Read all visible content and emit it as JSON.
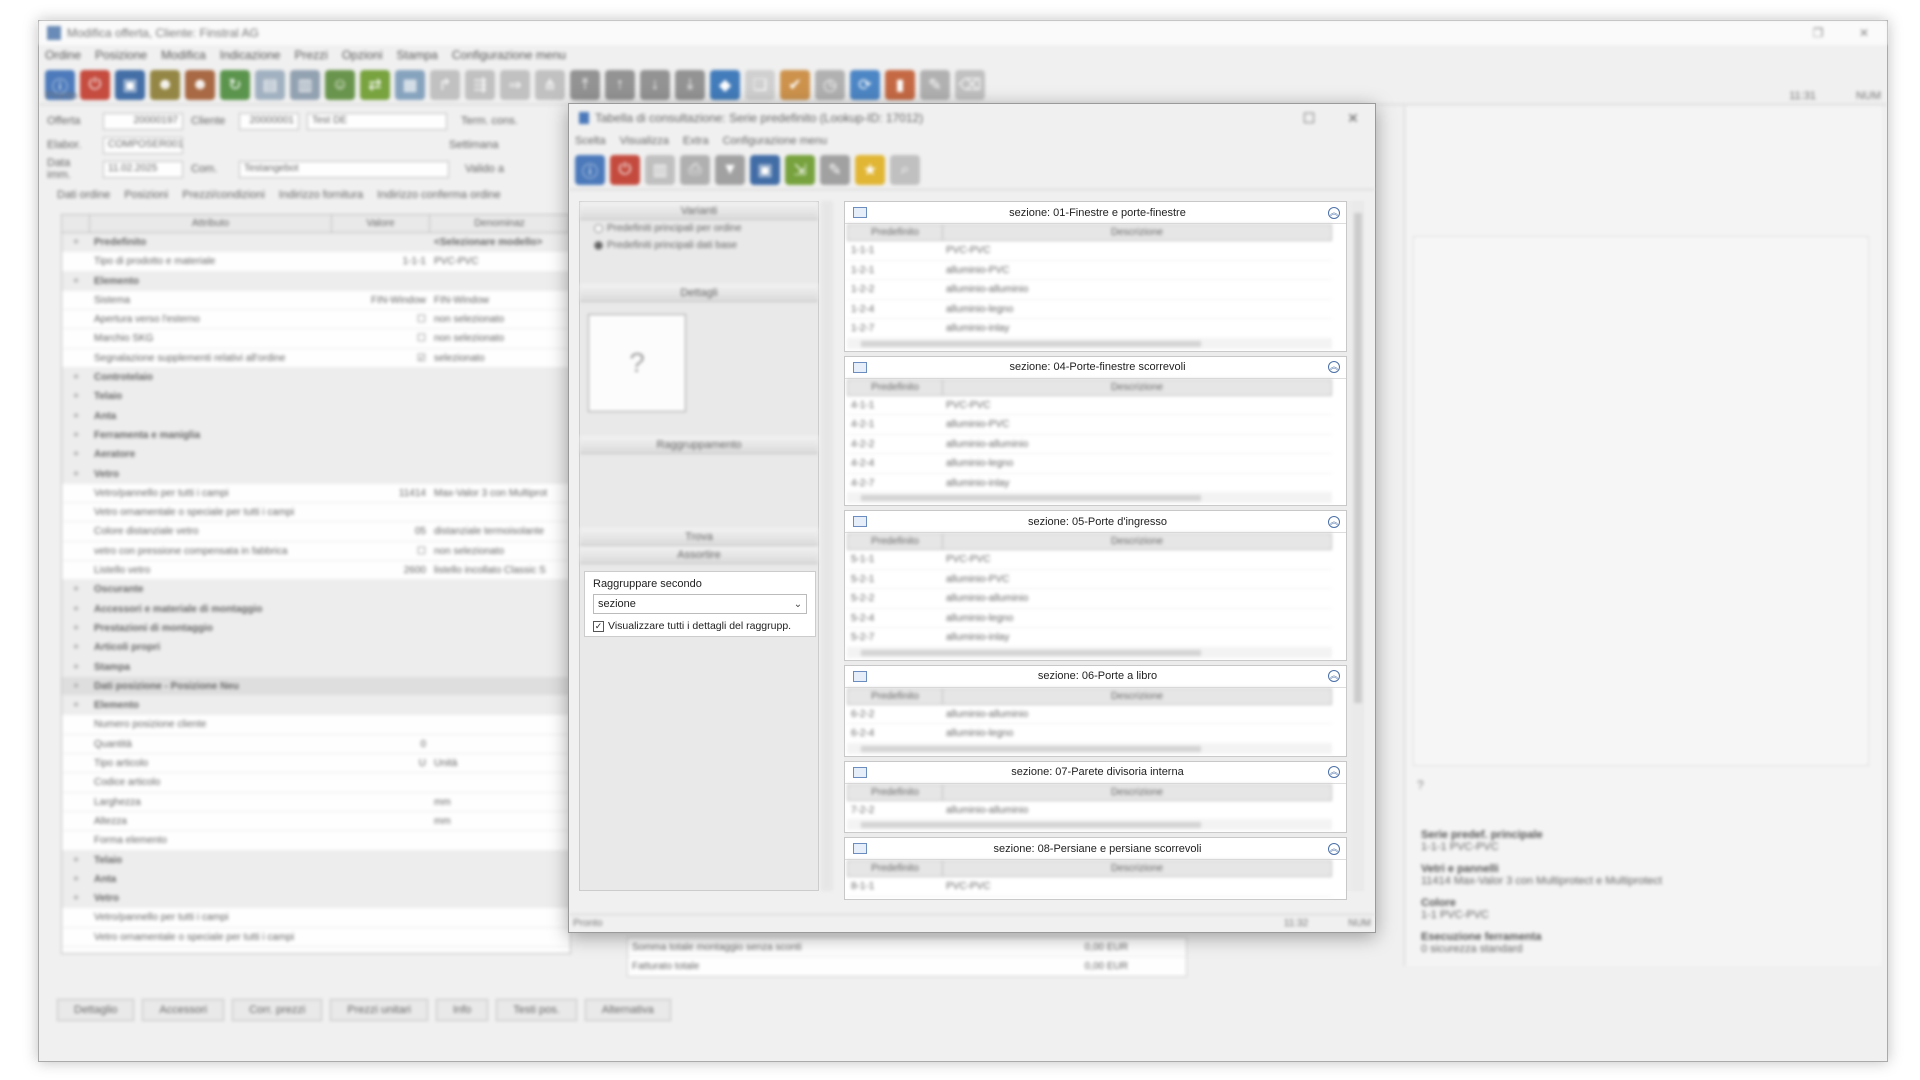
{
  "main": {
    "title": "Modifica offerta, Cliente: Finstral AG",
    "menu": [
      "Ordine",
      "Posizione",
      "Modifica",
      "Indicazione",
      "Prezzi",
      "Opzioni",
      "Stampa",
      "Configurazione menu"
    ],
    "header": {
      "offerta_label": "Offerta",
      "offerta_value": "20000197",
      "cliente_label": "Cliente",
      "cliente_value": "20000001",
      "cliente_name": "Test DE",
      "elabor_label": "Elabor.",
      "elabor_value": "COMPOSER001",
      "data_label": "Data imm.",
      "data_value": "11.02.2025",
      "com_label": "Com.",
      "com_value": "Testangebot",
      "term_label": "Term. cons.",
      "settimana_label": "Settimana",
      "valido_label": "Valido a"
    },
    "tabs": [
      "Dati ordine",
      "Posizioni",
      "Prezzi/condizioni",
      "Indirizzo fornitura",
      "Indirizzo conferma ordine"
    ],
    "prop_headers": [
      "Attributo",
      "Valore",
      "Denominaz"
    ],
    "props": [
      {
        "t": "grp",
        "a": "Predefinito",
        "v": "",
        "d": "<Selezionare modello>"
      },
      {
        "t": "",
        "a": "Tipo di prodotto e materiale",
        "v": "1-1-1",
        "d": "PVC-PVC"
      },
      {
        "t": "grp",
        "a": "Elemento",
        "v": "",
        "d": ""
      },
      {
        "t": "",
        "a": "Sistema",
        "v": "FIN-Window",
        "d": "FIN-Window"
      },
      {
        "t": "",
        "a": "Apertura verso l'esterno",
        "v": "☐",
        "d": "non selezionato"
      },
      {
        "t": "",
        "a": "Marchio SKG",
        "v": "☐",
        "d": "non selezionato"
      },
      {
        "t": "",
        "a": "Segnalazione supplementi relativi all'ordine",
        "v": "☑",
        "d": "selezionato"
      },
      {
        "t": "grp",
        "a": "Controtelaio",
        "v": "",
        "d": ""
      },
      {
        "t": "grp",
        "a": "Telaio",
        "v": "",
        "d": ""
      },
      {
        "t": "grp",
        "a": "Anta",
        "v": "",
        "d": ""
      },
      {
        "t": "grp",
        "a": "Ferramenta e maniglia",
        "v": "",
        "d": ""
      },
      {
        "t": "grp",
        "a": "Aeratore",
        "v": "",
        "d": ""
      },
      {
        "t": "grp",
        "a": "Vetro",
        "v": "",
        "d": ""
      },
      {
        "t": "",
        "a": "Vetro/pannello per tutti i campi",
        "v": "11414",
        "d": "Max-Valor 3 con Multiprot"
      },
      {
        "t": "",
        "a": "Vetro ornamentale o speciale per tutti i campi",
        "v": "",
        "d": ""
      },
      {
        "t": "",
        "a": "Colore distanziale vetro",
        "v": "05",
        "d": "distanziale termoisolante"
      },
      {
        "t": "",
        "a": "vetro con pressione compensata in fabbrica",
        "v": "☐",
        "d": "non selezionato"
      },
      {
        "t": "",
        "a": "Listello vetro",
        "v": "2600",
        "d": "listello incollato Classic S"
      },
      {
        "t": "grp",
        "a": "Oscurante",
        "v": "",
        "d": ""
      },
      {
        "t": "grp",
        "a": "Accessori e materiale di montaggio",
        "v": "",
        "d": ""
      },
      {
        "t": "grp",
        "a": "Prestazioni di montaggio",
        "v": "",
        "d": ""
      },
      {
        "t": "grp",
        "a": "Articoli propri",
        "v": "",
        "d": ""
      },
      {
        "t": "grp",
        "a": "Stampa",
        "v": "",
        "d": ""
      },
      {
        "t": "sec",
        "a": "Dati posizione - Posizione Neu",
        "v": "",
        "d": ""
      },
      {
        "t": "grp",
        "a": "Elemento",
        "v": "",
        "d": ""
      },
      {
        "t": "",
        "a": "Numero posizione cliente",
        "v": "",
        "d": ""
      },
      {
        "t": "",
        "a": "Quantità",
        "v": "0",
        "d": ""
      },
      {
        "t": "",
        "a": "Tipo articolo",
        "v": "U",
        "d": "Unità"
      },
      {
        "t": "",
        "a": "Codice articolo",
        "v": "",
        "d": ""
      },
      {
        "t": "",
        "a": "Larghezza",
        "v": "",
        "d": "mm"
      },
      {
        "t": "",
        "a": "Altezza",
        "v": "",
        "d": "mm"
      },
      {
        "t": "",
        "a": "Forma elemento",
        "v": "",
        "d": ""
      },
      {
        "t": "grp",
        "a": "Telaio",
        "v": "",
        "d": ""
      },
      {
        "t": "grp",
        "a": "Anta",
        "v": "",
        "d": ""
      },
      {
        "t": "grp",
        "a": "Vetro",
        "v": "",
        "d": ""
      },
      {
        "t": "",
        "a": "Vetro/pannello per tutti i campi",
        "v": "",
        "d": ""
      },
      {
        "t": "",
        "a": "Vetro ornamentale o speciale per tutti i campi",
        "v": "",
        "d": ""
      }
    ],
    "sums": [
      {
        "label": "Somma totale montaggio senza sconti",
        "value": "0,00 EUR"
      },
      {
        "label": "Fatturato totale",
        "value": "0,00 EUR"
      }
    ],
    "bottom_buttons": [
      "Dettaglio",
      "Accessori",
      "Corr. prezzi",
      "Prezzi unitari",
      "Info",
      "Testi pos.",
      "Alternativa"
    ],
    "status_left": "Pronto",
    "status_time": "11:31",
    "status_num": "NUM",
    "info": {
      "q": "?",
      "s1_title": "Serie predef. principale",
      "s1_val": "1-1-1   PVC-PVC",
      "s2_title": "Vetri e pannelli",
      "s2_val": "11414   Max-Valor 3 con Multiprotect e Multiprotect",
      "s3_title": "Colore",
      "s3_val": "1-1   PVC-PVC",
      "s4_title": "Esecuzione ferramenta",
      "s4_val": "0       sicurezza standard"
    }
  },
  "dialog": {
    "title": "Tabella di consultazione: Serie predefinito (Lookup-ID: 17012)",
    "menu": [
      "Scelta",
      "Visualizza",
      "Extra",
      "Configurazione menu"
    ],
    "left": {
      "varianti_label": "Varianti",
      "radio1": "Predefiniti principali per ordine",
      "radio2": "Predefiniti principali dati base",
      "dettagli_label": "Dettagli",
      "q": "?",
      "raggr_label": "Raggruppamento",
      "group_by_label": "Raggruppare secondo",
      "group_by_value": "sezione",
      "show_all_label": "Visualizzare tutti i dettagli del raggrupp.",
      "trova_label": "Trova",
      "assortire_label": "Assortire"
    },
    "col_pred": "Predefinito",
    "col_desc": "Descrizione",
    "sections": [
      {
        "title": "sezione: 01-Finestre e porte-finestre",
        "rows": [
          [
            "1-1-1",
            "PVC-PVC"
          ],
          [
            "1-2-1",
            "alluminio-PVC"
          ],
          [
            "1-2-2",
            "alluminio-alluminio"
          ],
          [
            "1-2-4",
            "alluminio-legno"
          ],
          [
            "1-2-7",
            "alluminio-inlay"
          ]
        ]
      },
      {
        "title": "sezione: 04-Porte-finestre scorrevoli",
        "rows": [
          [
            "4-1-1",
            "PVC-PVC"
          ],
          [
            "4-2-1",
            "alluminio-PVC"
          ],
          [
            "4-2-2",
            "alluminio-alluminio"
          ],
          [
            "4-2-4",
            "alluminio-legno"
          ],
          [
            "4-2-7",
            "alluminio-inlay"
          ]
        ]
      },
      {
        "title": "sezione: 05-Porte d'ingresso",
        "rows": [
          [
            "5-1-1",
            "PVC-PVC"
          ],
          [
            "5-2-1",
            "alluminio-PVC"
          ],
          [
            "5-2-2",
            "alluminio-alluminio"
          ],
          [
            "5-2-4",
            "alluminio-legno"
          ],
          [
            "5-2-7",
            "alluminio-inlay"
          ]
        ]
      },
      {
        "title": "sezione: 06-Porte a libro",
        "rows": [
          [
            "6-2-2",
            "alluminio-alluminio"
          ],
          [
            "6-2-4",
            "alluminio-legno"
          ]
        ]
      },
      {
        "title": "sezione: 07-Parete divisoria interna",
        "rows": [
          [
            "7-2-2",
            "alluminio-alluminio"
          ]
        ]
      },
      {
        "title": "sezione: 08-Persiane e persiane scorrevoli",
        "rows": [
          [
            "8-1-1",
            "PVC-PVC"
          ]
        ]
      }
    ],
    "status_left": "Pronto",
    "status_time": "11:32",
    "status_num": "NUM"
  }
}
